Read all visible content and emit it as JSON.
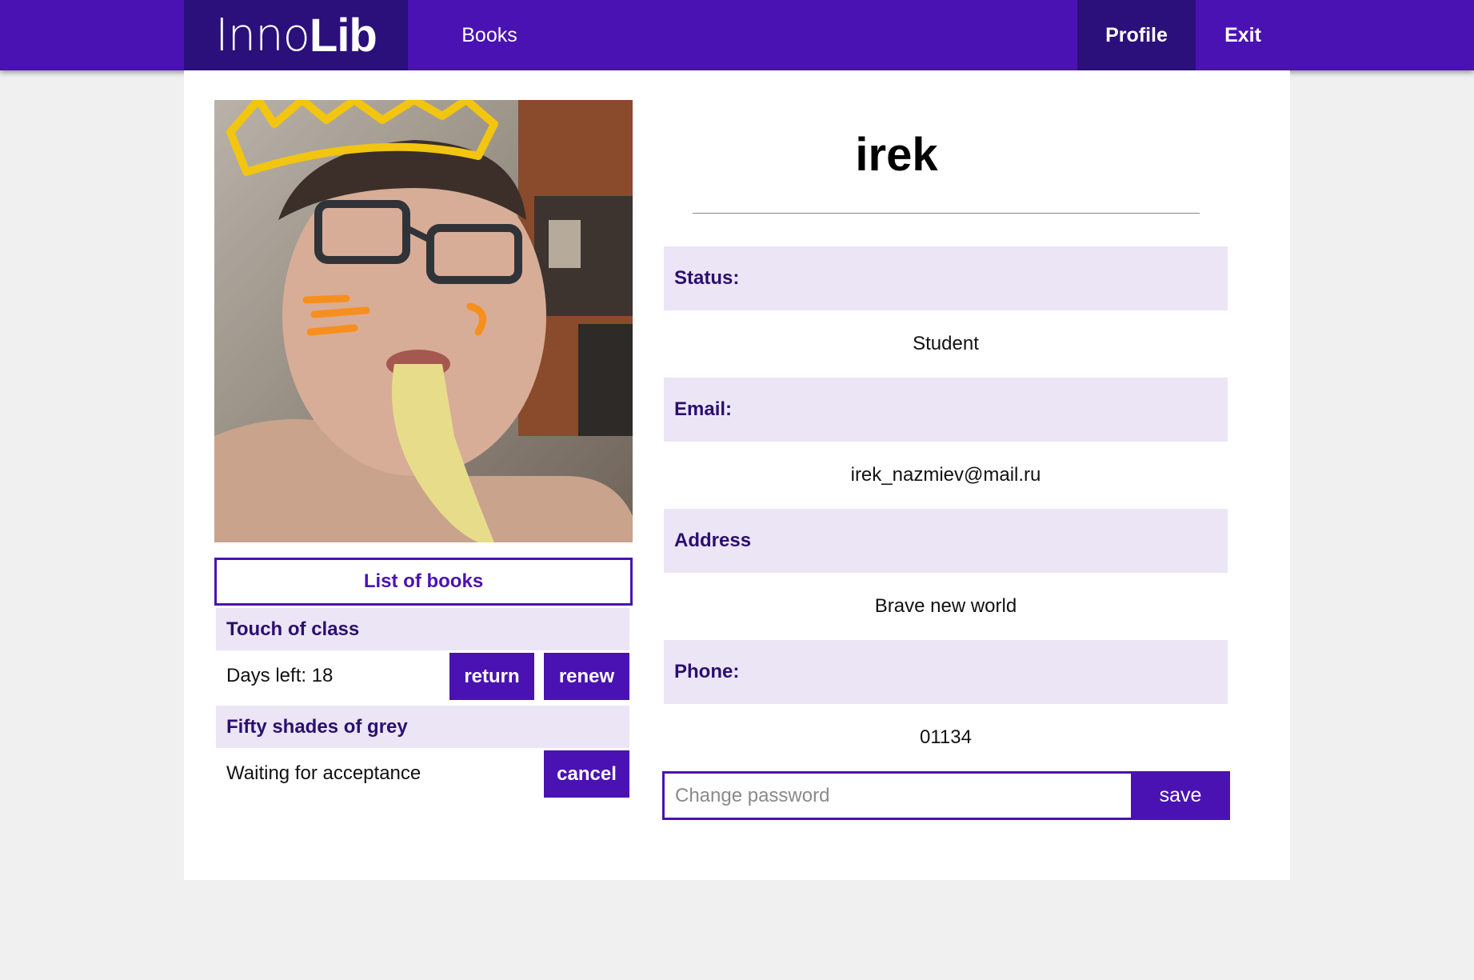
{
  "colors": {
    "primary": "#4a12b3",
    "primary_dark": "#2b0f7a",
    "label_bg": "#ebe5f6",
    "label_text": "#2b0f6e"
  },
  "nav": {
    "brand_light": "Inno",
    "brand_bold": "Lib",
    "books": "Books",
    "profile": "Profile",
    "exit": "Exit"
  },
  "profile": {
    "username": "irek",
    "photo_icon": "user-photo",
    "fields": [
      {
        "label": "Status:",
        "value": "Student"
      },
      {
        "label": "Email:",
        "value": "irek_nazmiev@mail.ru"
      },
      {
        "label": "Address",
        "value": "Brave new world"
      },
      {
        "label": "Phone:",
        "value": "01134"
      }
    ],
    "password": {
      "placeholder": "Change password",
      "save_label": "save"
    }
  },
  "books": {
    "list_label": "List of books",
    "items": [
      {
        "title": "Touch of class",
        "status": "Days left: 18",
        "actions": [
          "return",
          "renew"
        ]
      },
      {
        "title": "Fifty shades of grey",
        "status": "Waiting for acceptance",
        "actions": [
          "cancel"
        ]
      }
    ]
  }
}
